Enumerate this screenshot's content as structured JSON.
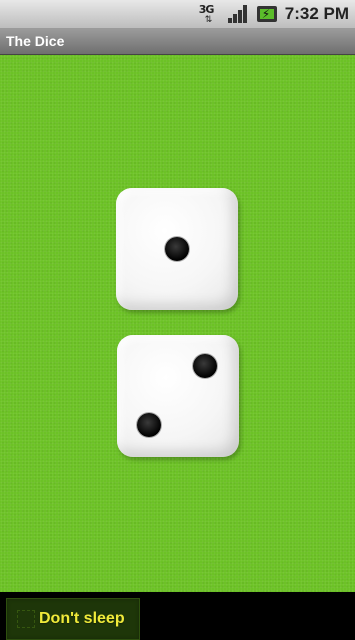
{
  "status_bar": {
    "network_icon": "3g-icon",
    "network_label": "3G",
    "signal_icon": "signal-icon",
    "battery_icon": "battery-charging-icon",
    "time": "7:32 PM"
  },
  "app": {
    "title": "The Dice"
  },
  "dice": [
    {
      "value": 1
    },
    {
      "value": 2
    }
  ],
  "controls": {
    "dont_sleep_label": "Don't sleep",
    "dont_sleep_checked": false
  },
  "colors": {
    "felt": "#6cc226",
    "label": "#f0ea3a"
  }
}
